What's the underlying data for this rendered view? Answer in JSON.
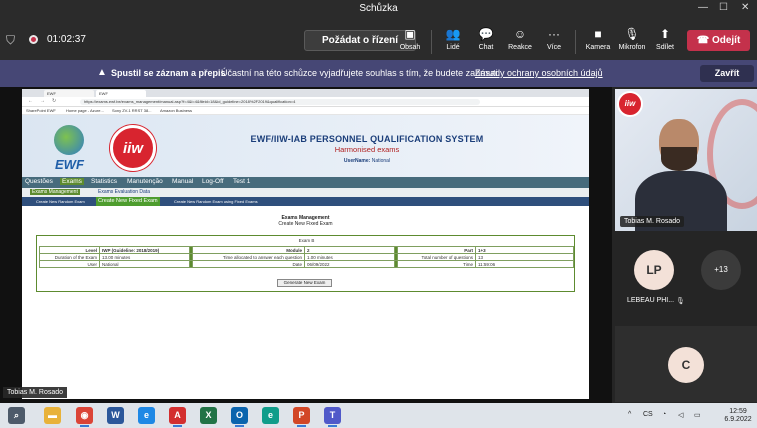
{
  "window": {
    "title": "Schůzka"
  },
  "meeting": {
    "timer": "01:02:37",
    "control_label": "Požádat o řízení",
    "tools": [
      {
        "label": "Obsah",
        "icon": "content-icon"
      },
      {
        "label": "Lidé",
        "icon": "people-icon"
      },
      {
        "label": "Chat",
        "icon": "chat-icon"
      },
      {
        "label": "Reakce",
        "icon": "reactions-icon"
      },
      {
        "label": "Více",
        "icon": "more-icon"
      },
      {
        "label": "Kamera",
        "icon": "camera-off-icon"
      },
      {
        "label": "Mikrofon",
        "icon": "mic-off-icon"
      },
      {
        "label": "Sdílet",
        "icon": "share-icon"
      }
    ],
    "leave_label": "Odejít",
    "leave_color": "#c4314b"
  },
  "banner": {
    "bold": "Spustil se záznam a přepis",
    "text": "Účastní na této schůzce vyjadřujete souhlas s tím, že budete zahrnuti.",
    "link": "Zásady ochrany osobních údajů",
    "close_label": "Zavřít",
    "color": "#464775"
  },
  "shared": {
    "tabs": [
      "EWF",
      "EWF"
    ],
    "url": "https://exams.ewf.be/exams_management/manual.asp?f=4&l=4&fileid=18&id_guideline=2018%2F2019&qualification=4"
  },
  "bookmarks": [
    "SharePoint EWF",
    "Home page - Azure...",
    "Sony ZV-1 RRST 38...",
    "Amazon Business"
  ],
  "ewf": {
    "system_title": "EWF/IIW-IAB PERSONNEL QUALIFICATION SYSTEM",
    "subtitle": "Harmonised exams",
    "user_label": "UserName:",
    "user_value": "National",
    "logo_text": "EWF",
    "iiw_text": "iiw"
  },
  "menu": [
    "Questões",
    "Exams",
    "Statistics",
    "Manutenção",
    "Manual",
    "Log-Off",
    "Test 1"
  ],
  "submenu": [
    "Exams Management",
    "Exams Evaluation Data"
  ],
  "subsubmenu": [
    "Create New Random Exam",
    "Create New Fixed Exam",
    "Create New Random Exam using Fixed Exams"
  ],
  "page": {
    "title": "Exams Management",
    "subtitle": "Create New Fixed Exam",
    "exam_caption": "Exam B",
    "rows": [
      [
        "Level",
        "IWP  (Guideline: 2018/2019)",
        "Module",
        "2",
        "Part",
        "1+3"
      ],
      [
        "Duration of the Exam",
        "13.00 minutes",
        "Time allocated to answer each question",
        "1.00 minutes",
        "Total number of questions",
        "13"
      ],
      [
        "User",
        "National",
        "Date",
        "06/09/2022",
        "Time",
        "11:59:06"
      ]
    ],
    "generate_label": "Generate New Exam"
  },
  "participants": {
    "presenter": "Tobias M. Rosado",
    "lp_initials": "LP",
    "lp_name": "LEBEAU PHI...",
    "more": "+13",
    "c_initials": "C"
  },
  "caption_tag": "Tobias M. Rosado",
  "taskbar": {
    "apps": [
      {
        "icon": "search-icon",
        "color": "#4d5a6a",
        "glyph": "⌕"
      },
      {
        "icon": "explorer-icon",
        "color": "#e8b23a",
        "glyph": "▬"
      },
      {
        "icon": "chrome-icon",
        "color": "#db4437",
        "glyph": "◉"
      },
      {
        "icon": "word-icon",
        "color": "#2b579a",
        "glyph": "W"
      },
      {
        "icon": "edge-icon",
        "color": "#1e88e5",
        "glyph": "e"
      },
      {
        "icon": "acrobat-icon",
        "color": "#d32f2f",
        "glyph": "A"
      },
      {
        "icon": "excel-icon",
        "color": "#217346",
        "glyph": "X"
      },
      {
        "icon": "outlook-icon",
        "color": "#0a64ad",
        "glyph": "O"
      },
      {
        "icon": "edge2-icon",
        "color": "#0f9d8a",
        "glyph": "e"
      },
      {
        "icon": "powerpoint-icon",
        "color": "#d24726",
        "glyph": "P"
      },
      {
        "icon": "teams-icon",
        "color": "#5059c9",
        "glyph": "T"
      }
    ],
    "lang": "CS",
    "time": "12:59",
    "date": "6.9.2022"
  }
}
